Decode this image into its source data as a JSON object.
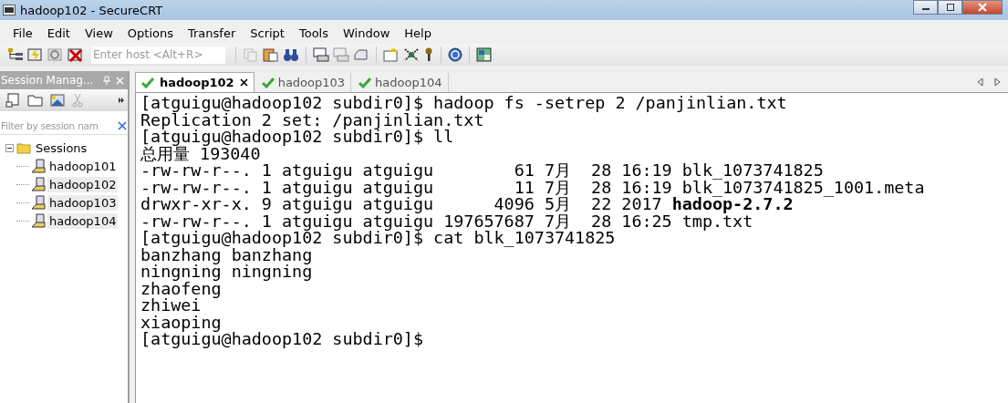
{
  "window": {
    "title": "hadoop102 - SecureCRT"
  },
  "menu": [
    "File",
    "Edit",
    "View",
    "Options",
    "Transfer",
    "Script",
    "Tools",
    "Window",
    "Help"
  ],
  "toolbar": {
    "host_field": {
      "placeholder": "Enter host <Alt+R>"
    }
  },
  "session_manager": {
    "title": "Session Manag...",
    "filter": {
      "placeholder": "Filter by session nam"
    },
    "tree": [
      {
        "label": "Sessions",
        "expanded": true,
        "children": [
          {
            "label": "hadoop101",
            "selected": false
          },
          {
            "label": "hadoop102",
            "selected": true
          },
          {
            "label": "hadoop103",
            "selected": true
          },
          {
            "label": "hadoop104",
            "selected": true
          }
        ]
      }
    ]
  },
  "tabs": [
    {
      "label": "hadoop102",
      "selected": true,
      "connected": true
    },
    {
      "label": "hadoop103",
      "selected": false,
      "connected": true
    },
    {
      "label": "hadoop104",
      "selected": false,
      "connected": true
    }
  ],
  "terminal": {
    "lines": [
      "[atguigu@hadoop102 subdir0]$ hadoop fs -setrep 2 /panjinlian.txt",
      "Replication 2 set: /panjinlian.txt",
      "[atguigu@hadoop102 subdir0]$ ll",
      "总用量 193040",
      "-rw-rw-r--. 1 atguigu atguigu        61 7月  28 16:19 blk_1073741825",
      "-rw-rw-r--. 1 atguigu atguigu        11 7月  28 16:19 blk_1073741825_1001.meta",
      "drwxr-xr-x. 9 atguigu atguigu      4096 5月  22 2017 **hadoop-2.7.2**",
      "-rw-rw-r--. 1 atguigu atguigu 197657687 7月  28 16:25 tmp.txt",
      "[atguigu@hadoop102 subdir0]$ cat blk_1073741825",
      "banzhang banzhang",
      "ningning ningning",
      "zhaofeng",
      "zhiwei",
      "xiaoping",
      "[atguigu@hadoop102 subdir0]$"
    ]
  }
}
